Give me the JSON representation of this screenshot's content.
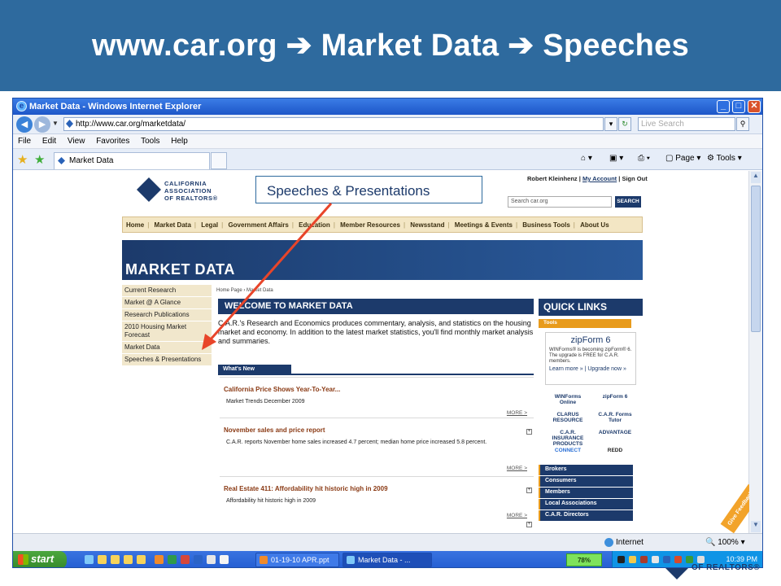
{
  "slide": {
    "title": "www.car.org  ➔ Market Data ➔ Speeches"
  },
  "colors": {
    "header_bg": "#2e6a9e",
    "car_navy": "#1c3a6b",
    "accent_orange": "#e89b1c",
    "arrow_red": "#e8452a"
  },
  "browser": {
    "window_title": "Market Data - Windows Internet Explorer",
    "url": "http://www.car.org/marketdata/",
    "search_placeholder": "Live Search",
    "menu": [
      "File",
      "Edit",
      "View",
      "Favorites",
      "Tools",
      "Help"
    ],
    "tab_title": "Market Data",
    "commands": {
      "page": "Page",
      "tools": "Tools"
    },
    "status": {
      "zone": "Internet",
      "zoom": "100%"
    }
  },
  "site": {
    "logo_lines": [
      "CALIFORNIA",
      "ASSOCIATION",
      "OF REALTORS®"
    ],
    "user_name": "Robert Kleinhenz",
    "account_link": "My Account",
    "signout_link": "Sign Out",
    "search_placeholder": "Search car.org",
    "search_button": "SEARCH",
    "nav": [
      "Home",
      "Market Data",
      "Legal",
      "Government Affairs",
      "Education",
      "Member Resources",
      "Newsstand",
      "Meetings & Events",
      "Business Tools",
      "About Us"
    ],
    "banner": "MARKET  DATA",
    "left_nav": [
      "Current Research",
      "Market @ A Glance",
      "Research Publications",
      "2010 Housing Market Forecast",
      "Market Data",
      "Speeches & Presentations"
    ],
    "breadcrumb": "Home Page › Market Data",
    "welcome": "WELCOME TO MARKET DATA",
    "intro": "C.A.R.'s Research and Economics produces commentary, analysis, and statistics on the housing market and economy. In addition to the latest market statistics, you'll find monthly market analysis and summaries.",
    "whats_new": "What's New",
    "news": [
      {
        "title": "California Price Shows Year-To-Year...",
        "body": "Market Trends December 2009",
        "more": "MORE >"
      },
      {
        "title": "November sales and price report",
        "body": "C.A.R. reports November home sales increased 4.7 percent; median home price increased 5.8 percent.",
        "more": "MORE >"
      },
      {
        "title": "Real Estate 411: Affordability hit historic high in 2009",
        "body": "Affordability hit historic high in 2009",
        "more": "MORE >"
      }
    ],
    "quick_links": {
      "title": "QUICK LINKS",
      "tools_label": "Tools",
      "zipform_logo": "zipForm 6",
      "zipform_text": "WINForms® is becoming zipForm® 6. The upgrade is FREE for C.A.R. members.",
      "learn_more": "Learn more »",
      "upgrade": "Upgrade now »",
      "logos": [
        "WINForms Online",
        "zipForm 6",
        "CLARUS RESOURCE",
        "C.A.R. Forms Tutor",
        "C.A.R. INSURANCE PRODUCTS",
        "ADVANTAGE",
        "CONNECT",
        "REDD"
      ],
      "items": [
        "Brokers",
        "Consumers",
        "Members",
        "Local Associations",
        "C.A.R. Directors"
      ]
    },
    "feedback": "Give Feedback"
  },
  "callout": "Speeches & Presentations",
  "taskbar": {
    "start": "start",
    "tasks": [
      "01-19-10 APR.ppt",
      "Market Data - ..."
    ],
    "battery": "78%",
    "clock": "10:39 PM"
  },
  "footer_logo": "OF REALTORS®"
}
